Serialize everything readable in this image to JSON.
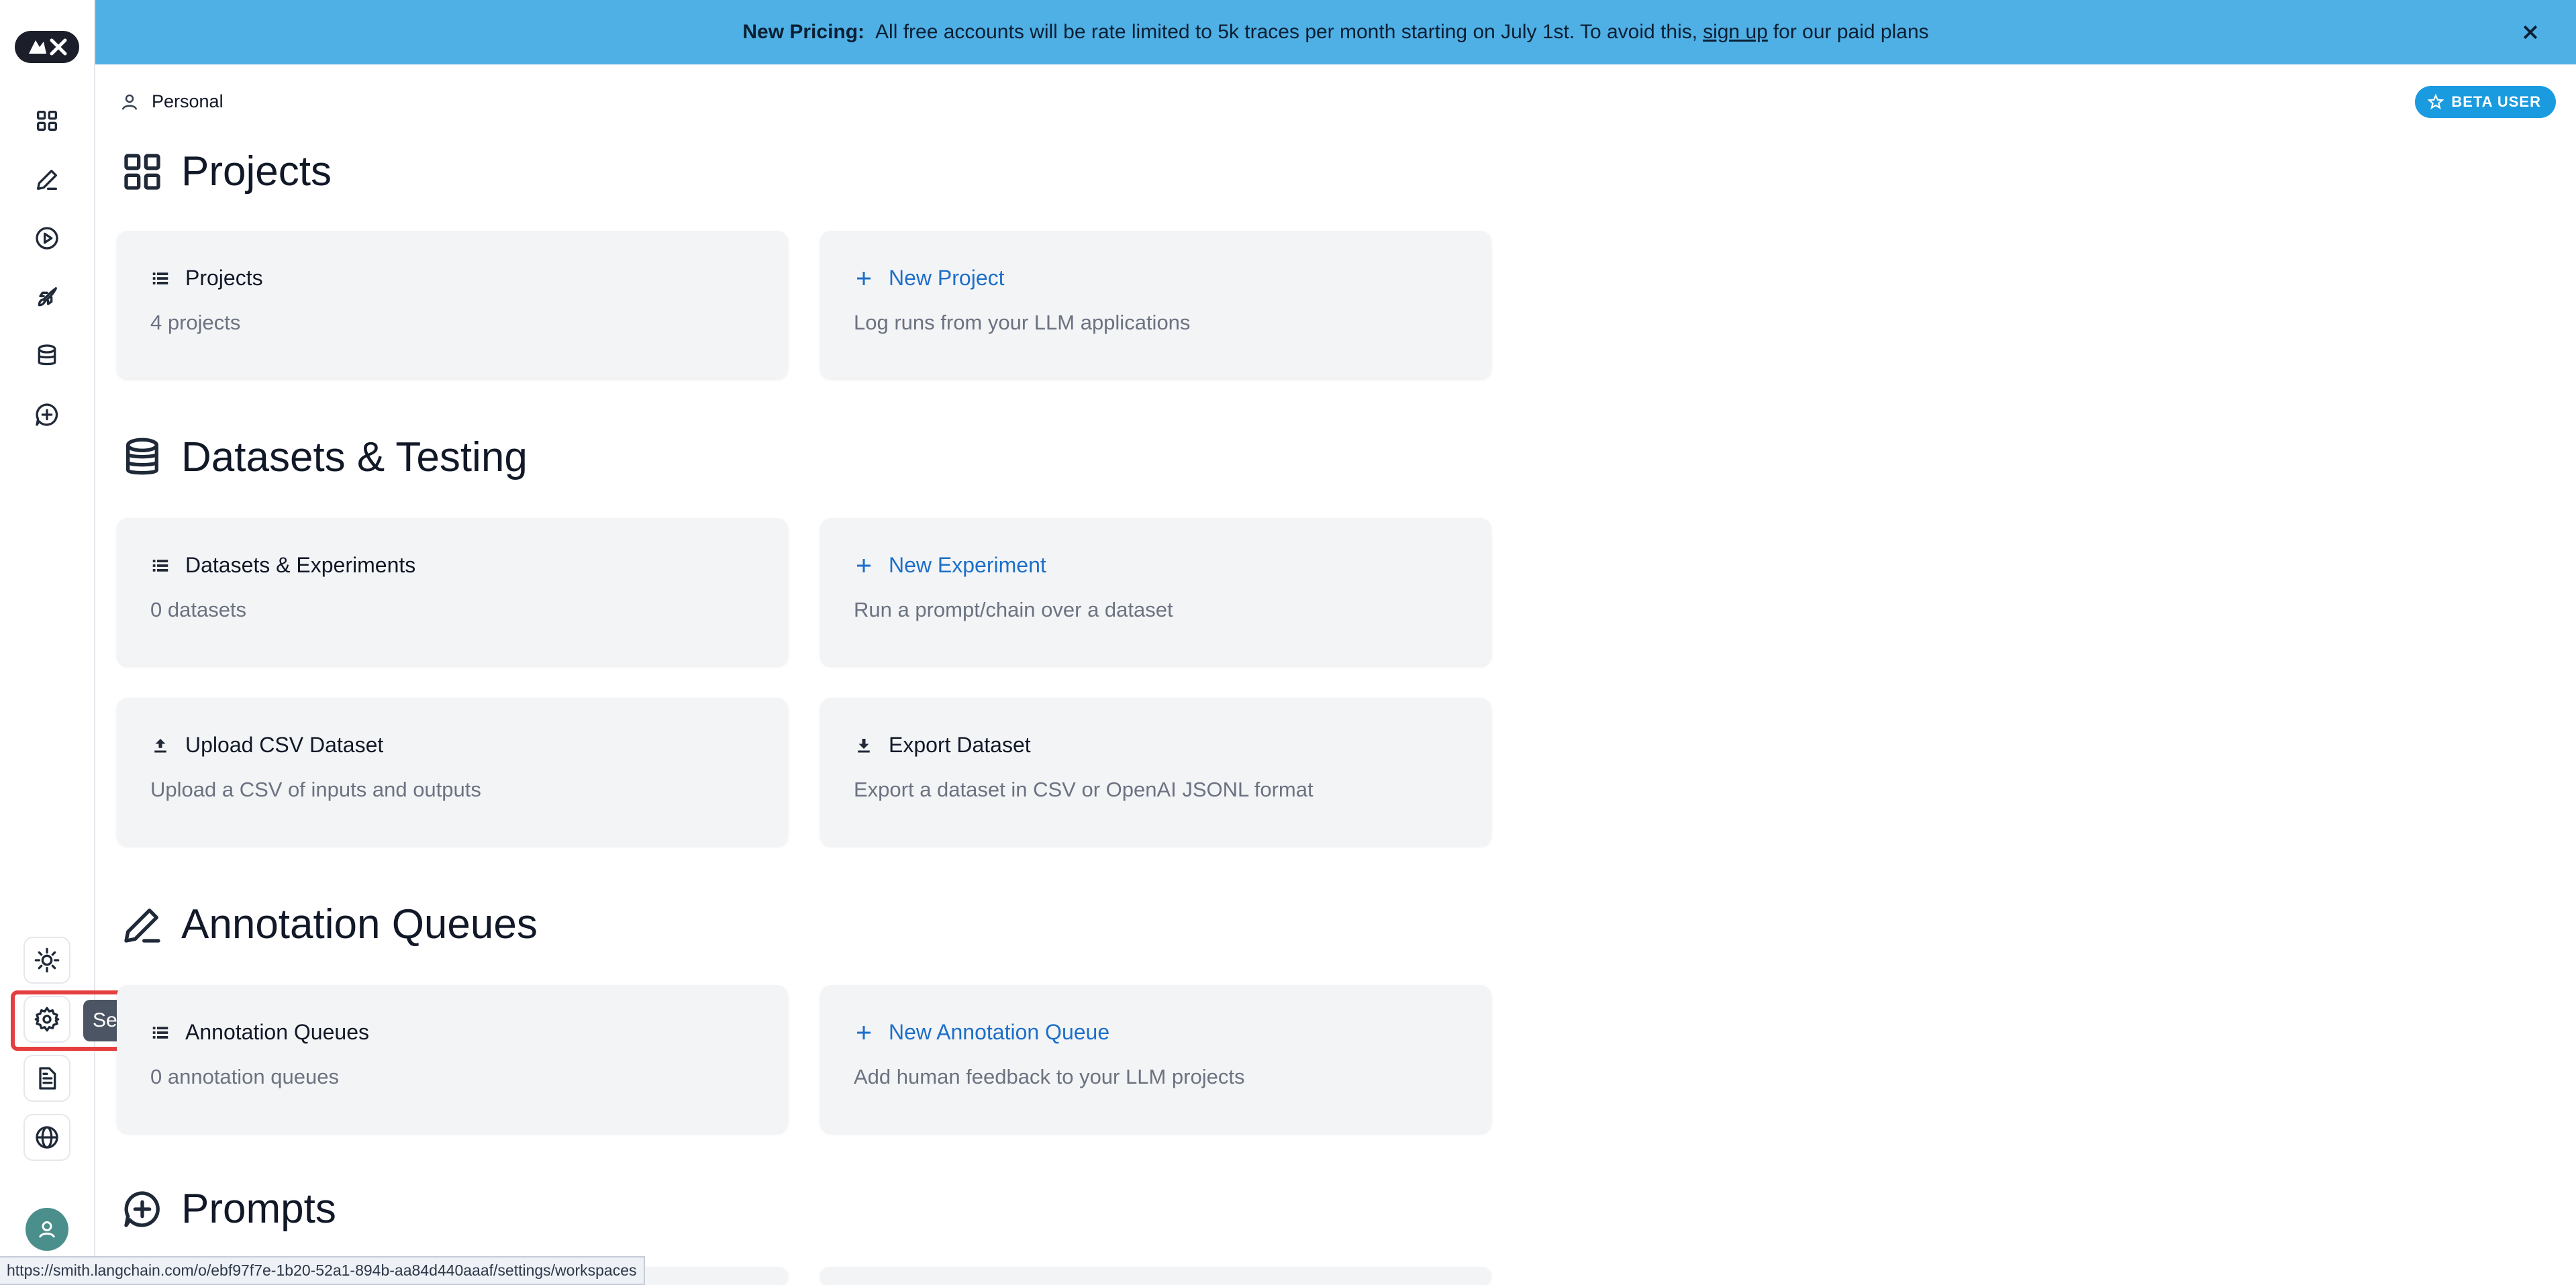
{
  "banner": {
    "bold": "New Pricing:",
    "text_before": "All free accounts will be rate limited to 5k traces per month starting on July 1st. To avoid this,",
    "link": "sign up",
    "text_after": "for our paid plans"
  },
  "breadcrumb": {
    "label": "Personal"
  },
  "badge": {
    "label": "BETA USER"
  },
  "tooltip": {
    "label": "Settings"
  },
  "sections": {
    "projects": {
      "title": "Projects",
      "card_list": {
        "title": "Projects",
        "sub": "4 projects"
      },
      "card_new": {
        "title": "New Project",
        "sub": "Log runs from your LLM applications"
      }
    },
    "datasets": {
      "title": "Datasets & Testing",
      "card_list": {
        "title": "Datasets & Experiments",
        "sub": "0 datasets"
      },
      "card_new": {
        "title": "New Experiment",
        "sub": "Run a prompt/chain over a dataset"
      },
      "card_upload": {
        "title": "Upload CSV Dataset",
        "sub": "Upload a CSV of inputs and outputs"
      },
      "card_export": {
        "title": "Export Dataset",
        "sub": "Export a dataset in CSV or OpenAI JSONL format"
      }
    },
    "annotation": {
      "title": "Annotation Queues",
      "card_list": {
        "title": "Annotation Queues",
        "sub": "0 annotation queues"
      },
      "card_new": {
        "title": "New Annotation Queue",
        "sub": "Add human feedback to your LLM projects"
      }
    },
    "prompts": {
      "title": "Prompts"
    }
  },
  "status_url": "https://smith.langchain.com/o/ebf97f7e-1b20-52a1-894b-aa84d440aaaf/settings/workspaces",
  "colors": {
    "banner": "#4fb0e6",
    "link": "#1d6fc9",
    "badge": "#1a9be0",
    "highlight": "#e53e3e"
  },
  "icons": [
    "grid-icon",
    "pencil-icon",
    "play-icon",
    "rocket-icon",
    "database-icon",
    "message-plus-icon",
    "sun-icon",
    "gear-icon",
    "document-icon",
    "globe-icon",
    "user-icon",
    "star-icon",
    "list-icon",
    "plus-icon",
    "upload-icon",
    "download-icon",
    "close-icon"
  ]
}
